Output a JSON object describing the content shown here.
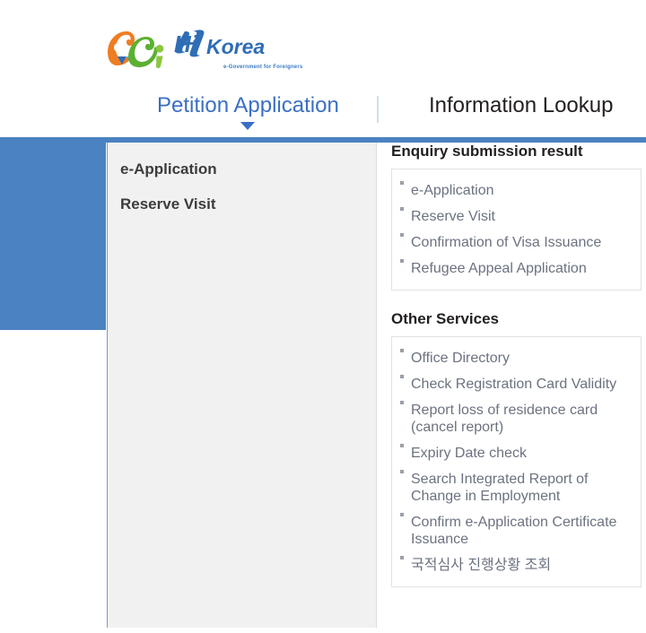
{
  "site": {
    "logo_title": "Hi Korea",
    "logo_tagline": "e-Government for Foreigners"
  },
  "nav": {
    "tabs": [
      {
        "label": "Petition Application",
        "active": true
      },
      {
        "label": "Information Lookup",
        "active": false
      }
    ]
  },
  "menu": {
    "items": [
      {
        "label": "e-Application"
      },
      {
        "label": "Reserve Visit"
      }
    ]
  },
  "sections": [
    {
      "title": "Enquiry submission result",
      "items": [
        {
          "label": "e-Application"
        },
        {
          "label": "Reserve Visit"
        },
        {
          "label": "Confirmation of Visa Issuance"
        },
        {
          "label": "Refugee Appeal Application"
        }
      ]
    },
    {
      "title": "Other Services",
      "items": [
        {
          "label": "Office Directory"
        },
        {
          "label": "Check Registration Card Validity"
        },
        {
          "label": "Report loss of residence card (cancel report)"
        },
        {
          "label": "Expiry Date check"
        },
        {
          "label": "Search Integrated Report of Change in Employment"
        },
        {
          "label": "Confirm e-Application Certificate Issuance"
        },
        {
          "label": "국적심사 진행상황 조회"
        }
      ]
    }
  ],
  "colors": {
    "accent_blue": "#4a82c2",
    "tab_active": "#3b6fc4",
    "panel_gray": "#f1f1f1",
    "list_text": "#6b7280"
  }
}
